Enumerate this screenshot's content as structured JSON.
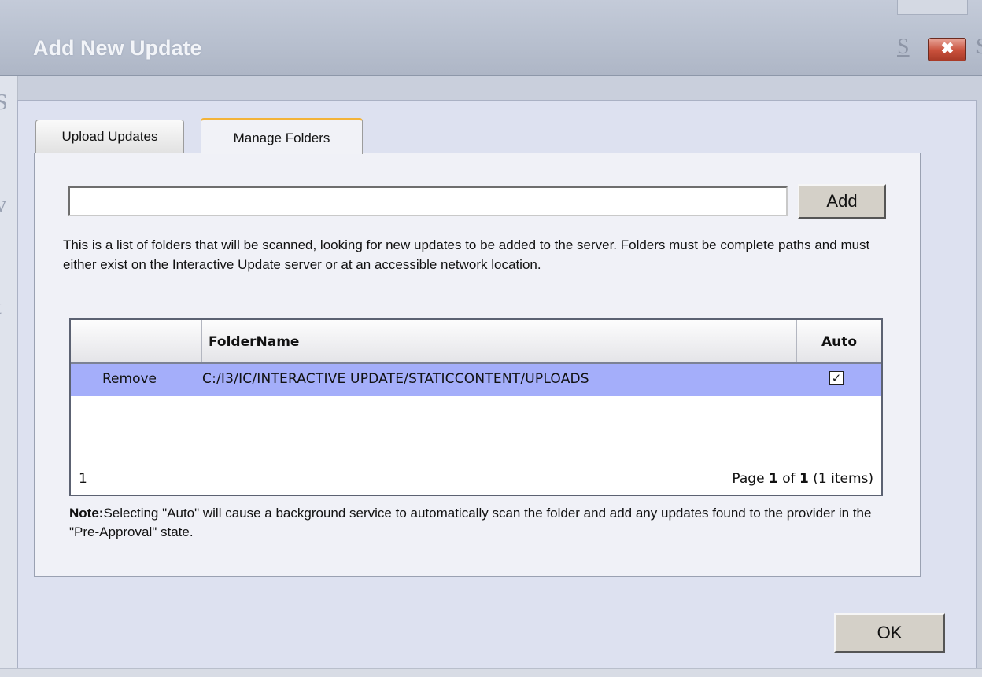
{
  "dialog": {
    "title": "Add New Update",
    "close_glyph": "✖",
    "ok_label": "OK"
  },
  "tabs": [
    {
      "label": "Upload Updates",
      "active": false
    },
    {
      "label": "Manage Folders",
      "active": true
    }
  ],
  "manage": {
    "folder_input_value": "",
    "add_label": "Add",
    "description": "This is a list of folders that will be scanned, looking for new updates to be added to the server. Folders must be complete paths and must either exist on the Interactive Update server or at an accessible network location.",
    "grid": {
      "columns": [
        "",
        "FolderName",
        "Auto"
      ],
      "rows": [
        {
          "action": "Remove",
          "folder": "C:/I3/IC/INTERACTIVE UPDATE/STATICCONTENT/UPLOADS",
          "auto": true
        }
      ],
      "pager_count": "1",
      "page_word": "Page",
      "page_current": "1",
      "of_word": "of",
      "page_total": "1",
      "items_text": "(1 items)"
    },
    "note_label": "Note:",
    "note_text": "Selecting \"Auto\" will cause a background service to automatically scan the folder and add any updates found to the provider in the \"Pre-Approval\" state."
  },
  "colors": {
    "selected_row": "#a4aefa",
    "active_tab_accent": "#f3b338",
    "close_button": "#c8503b"
  },
  "icons": {
    "close": "close-x-icon",
    "checkbox": "checkmark-icon"
  }
}
